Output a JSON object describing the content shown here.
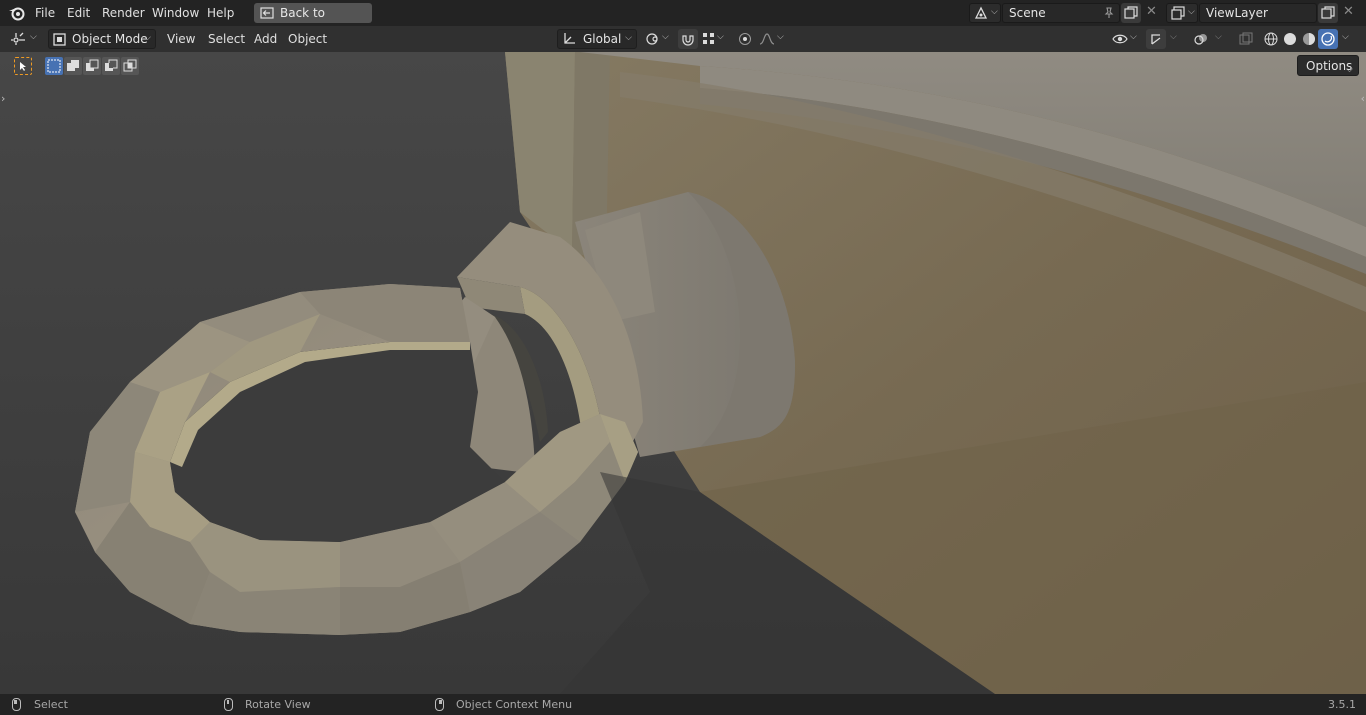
{
  "topbar": {
    "menus": [
      "File",
      "Edit",
      "Render",
      "Window",
      "Help"
    ],
    "back_button": "Back to Previous",
    "scene_name": "Scene",
    "view_layer": "ViewLayer"
  },
  "viewport_header": {
    "mode": "Object Mode",
    "menus": [
      "View",
      "Select",
      "Add",
      "Object"
    ],
    "transform_orientation": "Global"
  },
  "viewport": {
    "options_label": "Options"
  },
  "statusbar": {
    "left_click": "Select",
    "middle_click": "Rotate View",
    "right_click": "Object Context Menu",
    "version": "3.5.1"
  },
  "colors": {
    "accent_blue": "#4772b3",
    "active_tool_orange": "#ef9b24",
    "background_dark": "#3d3d3d"
  }
}
